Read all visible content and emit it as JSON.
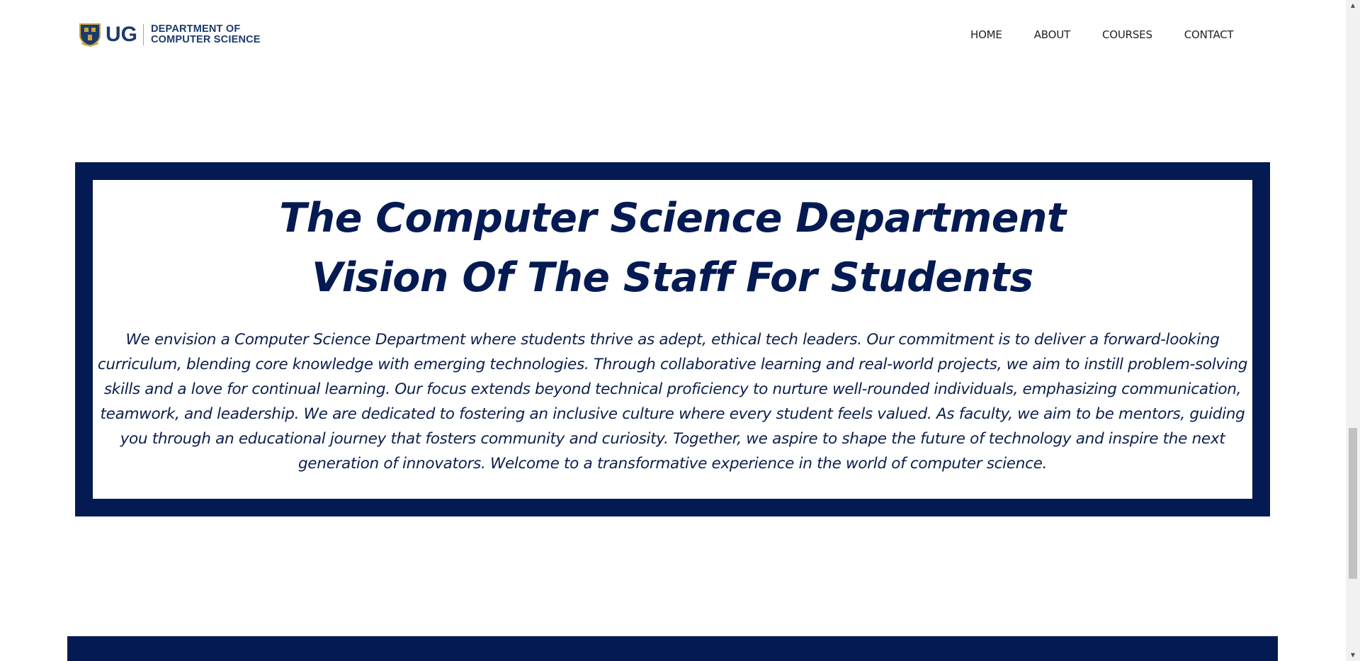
{
  "header": {
    "logo": {
      "short": "UG",
      "line1": "DEPARTMENT OF",
      "line2": "COMPUTER SCIENCE"
    },
    "nav": [
      {
        "label": "HOME"
      },
      {
        "label": "ABOUT"
      },
      {
        "label": "COURSES"
      },
      {
        "label": "CONTACT"
      }
    ]
  },
  "vision": {
    "title_line1": "The Computer Science Department",
    "title_line2": "Vision Of The Staff For Students",
    "body": "We envision a Computer Science Department where students thrive as adept, ethical tech leaders. Our commitment is to deliver a forward-looking curriculum, blending core knowledge with emerging technologies. Through collaborative learning and real-world projects, we aim to instill problem-solving skills and a love for continual learning. Our focus extends beyond technical proficiency to nurture well-rounded individuals, emphasizing communication, teamwork, and leadership. We are dedicated to fostering an inclusive culture where every student feels valued. As faculty, we aim to be mentors, guiding you through an educational journey that fosters community and curiosity. Together, we aspire to shape the future of technology and inspire the next generation of innovators. Welcome to a transformative experience in the world of computer science."
  },
  "colors": {
    "navy": "#041a52",
    "logo_blue": "#1c3a6e",
    "crest_gold": "#c9a53a"
  },
  "icons": {
    "crest": "university-crest-icon",
    "scroll_up": "scroll-up-arrow-icon",
    "scroll_down": "scroll-down-arrow-icon"
  }
}
